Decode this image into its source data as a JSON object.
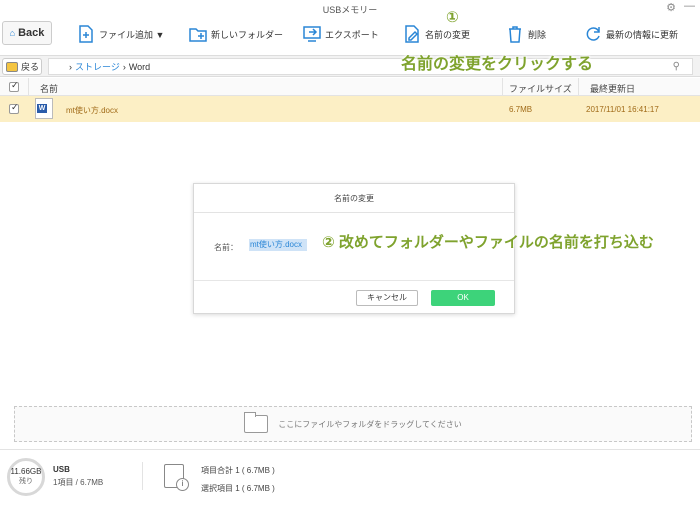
{
  "window": {
    "title": "USBメモリー"
  },
  "toolbar": {
    "back_label": "Back",
    "add_file_label": "ファイル追加 ▼",
    "new_folder_label": "新しいフォルダー",
    "export_label": "エクスポート",
    "rename_label": "名前の変更",
    "delete_label": "削除",
    "refresh_label": "最新の情報に更新"
  },
  "annotations": {
    "step1_number": "①",
    "step1_text": "名前の変更をクリックする",
    "step2_text": "② 改めてフォルダーやファイルの名前を打ち込む",
    "color": "#7fa32e"
  },
  "nav": {
    "home_label": "戻る",
    "breadcrumb_root": "ストレージ",
    "breadcrumb_current": "Word"
  },
  "table": {
    "columns": [
      "名前",
      "ファイルサイズ",
      "最終更新日"
    ],
    "rows": [
      {
        "name": "mt使い方.docx",
        "size": "6.7MB",
        "modified": "2017/11/01 16:41:17",
        "selected": true
      }
    ]
  },
  "dialog": {
    "title": "名前の変更",
    "name_label": "名前：",
    "name_value": "mt使い方.docx",
    "cancel_label": "キャンセル",
    "ok_label": "OK"
  },
  "dropzone": {
    "text": "ここにファイルやフォルダをドラッグしてください"
  },
  "status": {
    "free_space": "11.66GB",
    "free_label": "残り",
    "device_name": "USB",
    "device_summary": "1項目 / 6.7MB",
    "total_items": "項目合計 1 ( 6.7MB )",
    "selected_items": "選択項目 1 ( 6.7MB )"
  }
}
